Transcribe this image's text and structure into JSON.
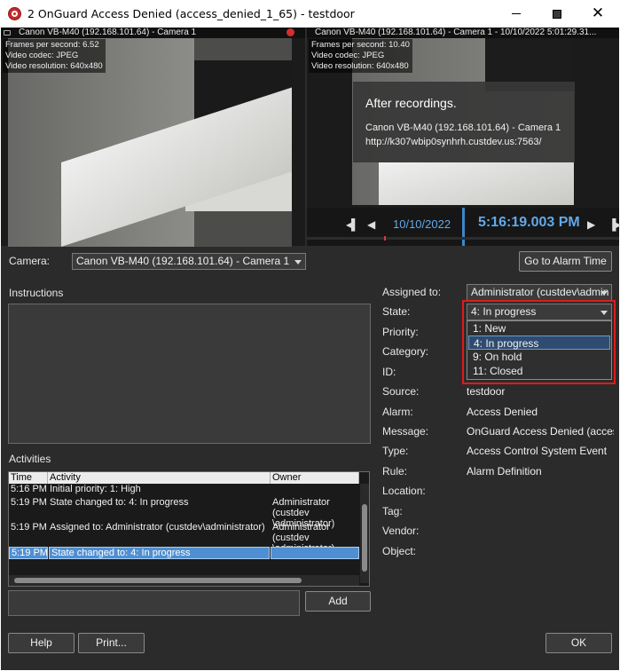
{
  "window": {
    "title": "2 OnGuard Access Denied (access_denied_1_65) - testdoor"
  },
  "left_video": {
    "title": "Canon VB-M40 (192.168.101.64) - Camera 1",
    "info": [
      "Frames per second: 6.52",
      "Video codec: JPEG",
      "Video resolution: 640x480"
    ]
  },
  "right_video": {
    "title": "Canon VB-M40 (192.168.101.64) - Camera 1 - 10/10/2022 5:01:29.31...",
    "info": [
      "Frames per second: 10.40",
      "Video codec: JPEG",
      "Video resolution: 640x480"
    ],
    "overlay": {
      "heading": "After recordings.",
      "camera": "Canon VB-M40 (192.168.101.64) - Camera 1",
      "url": "http://k307wbip0synhrh.custdev.us:7563/"
    },
    "timeline": {
      "date": "10/10/2022",
      "time": "5:16:19.003 PM"
    }
  },
  "camera": {
    "label": "Camera:",
    "value": "Canon VB-M40 (192.168.101.64) - Camera 1",
    "goto_label": "Go to Alarm Time"
  },
  "instructions": {
    "label": "Instructions",
    "text": ""
  },
  "activities": {
    "label": "Activities",
    "columns": [
      "Time",
      "Activity",
      "Owner"
    ],
    "rows": [
      {
        "time": "5:16 PM",
        "activity": "Initial priority: 1: High",
        "owner": ""
      },
      {
        "time": "5:19 PM",
        "activity": "State changed to: 4: In progress",
        "owner": "Administrator (custdev\n\\administrator)"
      },
      {
        "time": "5:19 PM",
        "activity": "Assigned to: Administrator (custdev\\administrator)",
        "owner": "Administrator (custdev\n\\administrator)"
      },
      {
        "time": "5:19 PM",
        "activity": "State changed to: 4: In progress",
        "owner": ""
      }
    ],
    "new_text": "",
    "add_label": "Add"
  },
  "details": {
    "assigned_to": {
      "label": "Assigned to:",
      "value": "Administrator (custdev\\admin"
    },
    "state": {
      "label": "State:",
      "value": "4: In progress",
      "options": [
        "1: New",
        "4: In progress",
        "9: On hold",
        "11: Closed"
      ]
    },
    "priority": {
      "label": "Priority:"
    },
    "category": {
      "label": "Category:"
    },
    "id": {
      "label": "ID:"
    },
    "source": {
      "label": "Source:",
      "value": "testdoor"
    },
    "alarm": {
      "label": "Alarm:",
      "value": "Access Denied"
    },
    "message": {
      "label": "Message:",
      "value": "OnGuard Access Denied (acces..."
    },
    "type": {
      "label": "Type:",
      "value": "Access Control System Event"
    },
    "rule": {
      "label": "Rule:",
      "value": "Alarm Definition"
    },
    "location": {
      "label": "Location:"
    },
    "tag": {
      "label": "Tag:"
    },
    "vendor": {
      "label": "Vendor:"
    },
    "object": {
      "label": "Object:"
    }
  },
  "footer": {
    "help_label": "Help",
    "print_label": "Print...",
    "ok_label": "OK"
  },
  "colors": {
    "accent": "#62a9ea",
    "highlight_border": "#e01b1b",
    "selection": "#4f8fd1"
  }
}
